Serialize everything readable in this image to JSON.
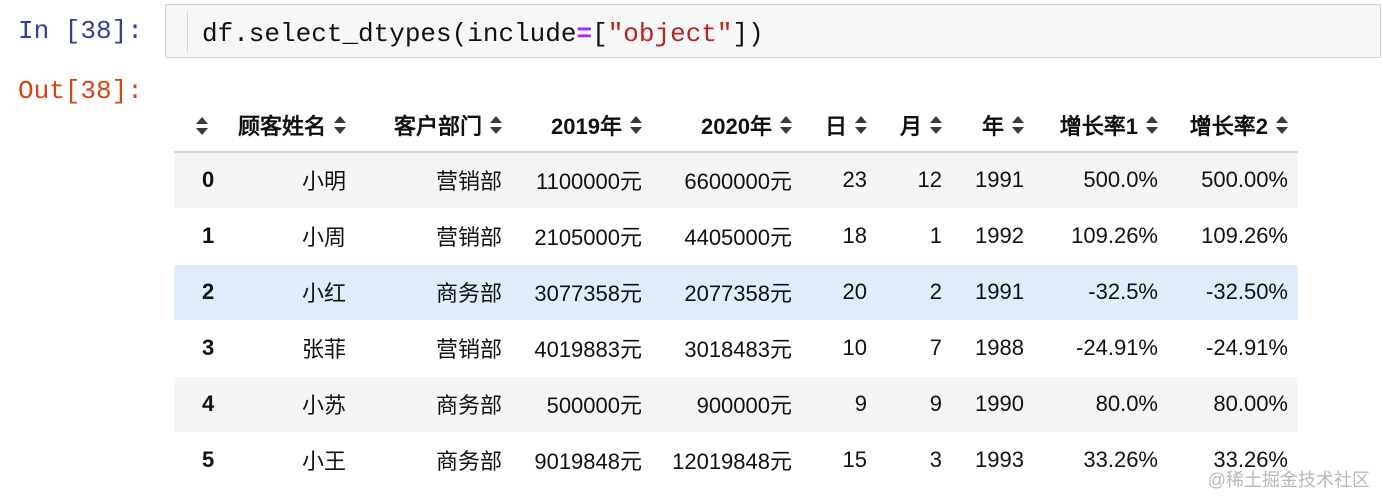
{
  "input_prompt": "In [38]:",
  "output_prompt": "Out[38]:",
  "code": {
    "part1": "df.select_dtypes(include",
    "op": "=",
    "part2": "[",
    "string": "\"object\"",
    "part3": "])"
  },
  "table": {
    "columns": [
      "顾客姓名",
      "客户部门",
      "2019年",
      "2020年",
      "日",
      "月",
      "年",
      "增长率1",
      "增长率2"
    ],
    "rows": [
      {
        "index": "0",
        "cells": [
          "小明",
          "营销部",
          "1100000元",
          "6600000元",
          "23",
          "12",
          "1991",
          "500.0%",
          "500.00%"
        ]
      },
      {
        "index": "1",
        "cells": [
          "小周",
          "营销部",
          "2105000元",
          "4405000元",
          "18",
          "1",
          "1992",
          "109.26%",
          "109.26%"
        ]
      },
      {
        "index": "2",
        "cells": [
          "小红",
          "商务部",
          "3077358元",
          "2077358元",
          "20",
          "2",
          "1991",
          "-32.5%",
          "-32.50%"
        ]
      },
      {
        "index": "3",
        "cells": [
          "张菲",
          "营销部",
          "4019883元",
          "3018483元",
          "10",
          "7",
          "1988",
          "-24.91%",
          "-24.91%"
        ]
      },
      {
        "index": "4",
        "cells": [
          "小苏",
          "商务部",
          "500000元",
          "900000元",
          "9",
          "9",
          "1990",
          "80.0%",
          "80.00%"
        ]
      },
      {
        "index": "5",
        "cells": [
          "小王",
          "商务部",
          "9019848元",
          "12019848元",
          "15",
          "3",
          "1993",
          "33.26%",
          "33.26%"
        ]
      }
    ],
    "highlighted_row": 2
  },
  "watermark": "@稀土掘金技术社区",
  "icons": {
    "sort": "sort-arrows-icon"
  },
  "colors": {
    "in_prompt": "#303f9f",
    "out_prompt": "#d84315",
    "row_highlight": "#deedf9",
    "row_stripe": "#f5f5f5",
    "string": "#ba2121",
    "operator": "#aa22ff"
  }
}
